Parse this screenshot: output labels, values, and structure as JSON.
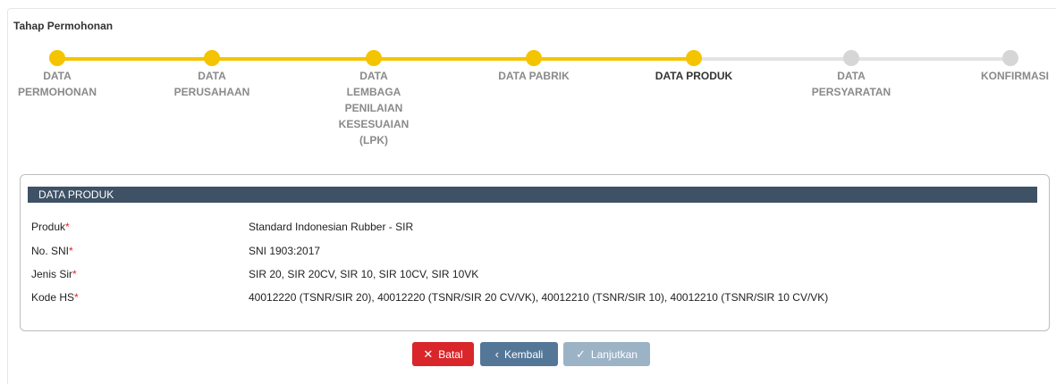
{
  "stepper": {
    "title": "Tahap Permohonan",
    "steps": [
      {
        "line1": "DATA",
        "line2": "PERMOHONAN",
        "line3": "",
        "line4": "",
        "line5": "",
        "line6": "",
        "state": "done"
      },
      {
        "line1": "DATA",
        "line2": "PERUSAHAAN",
        "line3": "",
        "line4": "",
        "line5": "",
        "line6": "",
        "state": "done"
      },
      {
        "line1": "DATA",
        "line2": "LEMBAGA",
        "line3": "PENILAIAN",
        "line4": "KESESUAIAN",
        "line5": "(LPK)",
        "line6": "",
        "state": "done"
      },
      {
        "line1": "DATA PABRIK",
        "line2": "",
        "line3": "",
        "line4": "",
        "line5": "",
        "line6": "",
        "state": "done"
      },
      {
        "line1": "DATA PRODUK",
        "line2": "",
        "line3": "",
        "line4": "",
        "line5": "",
        "line6": "",
        "state": "active"
      },
      {
        "line1": "DATA",
        "line2": "PERSYARATAN",
        "line3": "",
        "line4": "",
        "line5": "",
        "line6": "",
        "state": "todo"
      },
      {
        "line1": "KONFIRMASI",
        "line2": "",
        "line3": "",
        "line4": "",
        "line5": "",
        "line6": "",
        "state": "todo"
      }
    ]
  },
  "panel": {
    "header": "DATA PRODUK",
    "required_mark": "*",
    "rows": [
      {
        "label": "Produk",
        "value": "Standard Indonesian Rubber - SIR"
      },
      {
        "label": "No. SNI",
        "value": "SNI 1903:2017"
      },
      {
        "label": "Jenis Sir",
        "value": "SIR 20, SIR 20CV, SIR 10, SIR 10CV, SIR 10VK"
      },
      {
        "label": "Kode HS",
        "value": "40012220 (TSNR/SIR 20), 40012220 (TSNR/SIR 20 CV/VK), 40012210 (TSNR/SIR 10), 40012210 (TSNR/SIR 10 CV/VK)"
      }
    ]
  },
  "buttons": {
    "cancel": {
      "label": "Batal",
      "icon": "close-icon",
      "color": "#d9262b"
    },
    "back": {
      "label": "Kembali",
      "icon": "chevron-left-icon",
      "color": "#547798"
    },
    "next": {
      "label": "Lanjutkan",
      "icon": "check-icon",
      "color": "#9cb3c6"
    }
  },
  "colors": {
    "progress_done": "#f5c400",
    "progress_todo": "#d6d6d6",
    "panel_header": "#3e5165"
  }
}
